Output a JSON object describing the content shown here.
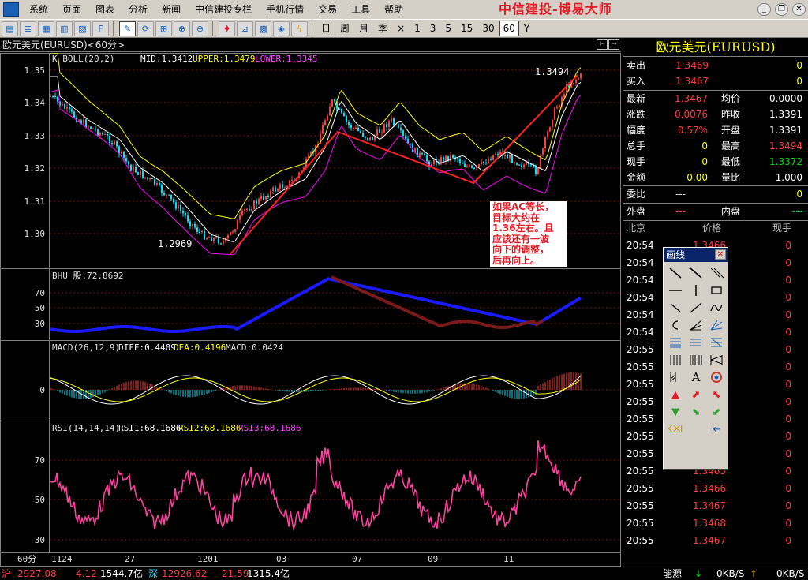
{
  "menu": {
    "items": [
      "系统",
      "页面",
      "图表",
      "分析",
      "新闻",
      "中信建投专栏",
      "手机行情",
      "交易",
      "工具",
      "帮助"
    ],
    "brand": "中信建投-博易大师"
  },
  "toolbar": {
    "periods": [
      "日",
      "周",
      "月",
      "季",
      "×",
      "1",
      "3",
      "5",
      "15",
      "30",
      "60",
      "Y"
    ],
    "selected_period": "60"
  },
  "chart": {
    "header": "欧元美元(EURUSD)<60分>",
    "period_label": "60分",
    "boll_label": "K   BOLL(20,2) MID:1.3412 UPPER:1.3479 LOWER:1.3345",
    "boll_prefix": "K   BOLL(20,2)",
    "boll_mid": "MID:1.3412",
    "boll_upper": "UPPER:1.3479",
    "boll_lower": "LOWER:1.3345",
    "price_axis": [
      "1.35",
      "1.34",
      "1.33",
      "1.32",
      "1.31",
      "1.30"
    ],
    "high_label": "1.3494",
    "low_label": "1.2969",
    "bhu_label": "BHU  股:72.8692",
    "bhu_axis": [
      "70",
      "50",
      "30"
    ],
    "macd_prefix": "MACD(26,12,9)",
    "macd_diff": "DIFF:0.4409",
    "macd_dea": "DEA:0.4196",
    "macd_val": "MACD:0.0424",
    "macd_axis": [
      "0"
    ],
    "rsi_prefix": "RSI(14,14,14)",
    "rsi1": "RSI1:68.1686",
    "rsi2": "RSI2:68.1686",
    "rsi3": "RSI3:68.1686",
    "rsi_axis": [
      "70",
      "50",
      "30"
    ],
    "date_axis": [
      "1124",
      "27",
      "1201",
      "03",
      "07",
      "09",
      "11"
    ],
    "annotation": "如果AC等长，目标大约在1.36左右。且应该还有一波向下的调整，后再向上。",
    "annotation_lines": [
      "如果AC等长，",
      "目标大约在",
      "1.36左右。且",
      "应该还有一波",
      "向下的调整，",
      "后再向上。"
    ]
  },
  "quote": {
    "title": "欧元美元(EURUSD)",
    "sell": {
      "label": "卖出",
      "price": "1.3469",
      "vol": "0"
    },
    "buy": {
      "label": "买入",
      "price": "1.3467",
      "vol": "0"
    },
    "stats": [
      {
        "l1": "最新",
        "v1": "1.3467",
        "l2": "均价",
        "v2": "0.0000"
      },
      {
        "l1": "涨跌",
        "v1": "0.0076",
        "l2": "昨收",
        "v2": "1.3391"
      },
      {
        "l1": "幅度",
        "v1": "0.57%",
        "l2": "开盘",
        "v2": "1.3391"
      },
      {
        "l1": "总手",
        "v1": "0",
        "l2": "最高",
        "v2": "1.3494"
      },
      {
        "l1": "现手",
        "v1": "0",
        "l2": "最低",
        "v2": "1.3372"
      },
      {
        "l1": "金额",
        "v1": "0.00",
        "l2": "量比",
        "v2": "1.000"
      }
    ],
    "weibi": {
      "label": "委比",
      "v1": "---",
      "v2": "0"
    },
    "waipan": {
      "label": "外盘",
      "v1": "---",
      "l2": "内盘",
      "v2": "---"
    },
    "tick_header": {
      "time": "北京",
      "price": "价格",
      "vol": "现手"
    },
    "ticks": [
      {
        "t": "20:54",
        "p": "1.3466",
        "v": "0"
      },
      {
        "t": "20:54",
        "p": "1.3466",
        "v": "0"
      },
      {
        "t": "20:54",
        "p": "1.3466",
        "v": "0"
      },
      {
        "t": "20:54",
        "p": "1.3466",
        "v": "0"
      },
      {
        "t": "20:54",
        "p": "1.3466",
        "v": "0"
      },
      {
        "t": "20:54",
        "p": "1.3466",
        "v": "0"
      },
      {
        "t": "20:55",
        "p": "1.3466",
        "v": "0"
      },
      {
        "t": "20:55",
        "p": "1.3466",
        "v": "0"
      },
      {
        "t": "20:55",
        "p": "1.3466",
        "v": "0"
      },
      {
        "t": "20:55",
        "p": "1.3466",
        "v": "0"
      },
      {
        "t": "20:55",
        "p": "1.3466",
        "v": "0"
      },
      {
        "t": "20:55",
        "p": "1.3466",
        "v": "0"
      },
      {
        "t": "20:55",
        "p": "1.3466",
        "v": "0"
      },
      {
        "t": "20:55",
        "p": "1.3465",
        "v": "0"
      },
      {
        "t": "20:55",
        "p": "1.3466",
        "v": "0"
      },
      {
        "t": "20:55",
        "p": "1.3467",
        "v": "0"
      },
      {
        "t": "20:55",
        "p": "1.3468",
        "v": "0"
      },
      {
        "t": "20:55",
        "p": "1.3467",
        "v": "0"
      }
    ]
  },
  "drawing_tools": {
    "title": "画线"
  },
  "status": {
    "sh_label": "沪",
    "sh_index": "2927.08",
    "sh_change": "4.12",
    "sh_amount": "1544.7亿",
    "sz_label": "深",
    "sz_index": "12926.62",
    "sz_change": "21.59",
    "sz_amount": "1315.4亿",
    "energy": "能源",
    "down_speed": "0KB/S",
    "up_speed": "0KB/S"
  },
  "colors": {
    "up": "#ff3c3c",
    "down": "#00e5ff",
    "boll_upper": "#ffff00",
    "boll_lower": "#ff00ff",
    "line_mid": "#ffffff",
    "label_yellow": "#ffff00"
  }
}
